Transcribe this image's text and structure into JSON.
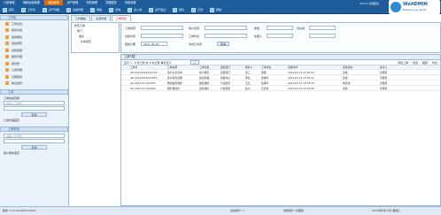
{
  "topnav": [
    "计划管理",
    "网络运维管理",
    "运营管理",
    "资产管理",
    "外勤管理",
    "流程服务",
    "系统设置"
  ],
  "toolbar": [
    "首页",
    "工作台",
    "资产管理",
    "设备管理",
    "网络",
    "查询",
    "出入库",
    "资产盘点",
    "报表",
    "日志",
    "帮助"
  ],
  "user": "admin [管理员]",
  "logo": {
    "name": "WeADMIN",
    "sub": "Powered by eSoft"
  },
  "left": {
    "panel1": "工作区",
    "menu": [
      "工作任务",
      "我的文档",
      "我的审批",
      "我的通知",
      "资料管理",
      "邮件管理",
      "通讯录",
      "公告管理",
      "日程安排",
      "信息发布"
    ],
    "panel2": "工单",
    "s1_title": "工单快速查看",
    "s1_placeholder": "请输入工单号",
    "btn": "查询",
    "s1_link": "工单管理首页",
    "s2_title": "工单查询",
    "s2_placeholder": "请输入关键字",
    "s2_link": "客户服务首页"
  },
  "tabs": [
    "工作面板",
    "资源管理",
    "工单列表"
  ],
  "tree": {
    "root": "所有工单",
    "items": [
      "部门",
      "组织",
      "基本配置"
    ]
  },
  "form": {
    "f1": "工单名称",
    "f2": "创建时间",
    "f3": "客户名称",
    "f4": "工单状态",
    "f5": "起始日期",
    "date": "2011-05-16",
    "f6": "类型",
    "f7": "处理人",
    "f8": "优先级",
    "check": "包含已关闭",
    "search": "查询"
  },
  "grid": {
    "title": "工单列表",
    "actions": [
      "添加工单",
      "修改",
      "删除",
      "导出"
    ],
    "pager": "显示 1 - 8 条记录 共 8 条记录 每页显示",
    "page": "1 / 1",
    "cols": [
      "",
      "工单号",
      "工单名称",
      "工单分类",
      "发起部门",
      "联系人",
      "工单状态",
      "创建时间",
      "完成状态",
      "提交人"
    ],
    "rows": [
      [
        "",
        "GD.2011021443A753",
        "客户信息查询",
        "客户服务",
        "客服部门",
        "张三",
        "受理",
        "2014-04-15 15:32:54",
        "完成",
        "管理员"
      ],
      [
        "",
        "GD.2011021443AH53",
        "客户投诉处理",
        "投诉处理",
        "客服中心",
        "李四",
        "处理中",
        "2014-04-15 15:35:11",
        "完成",
        "管理员"
      ],
      [
        "",
        "GD.2015-01-07DS21",
        "网络故障维修",
        "故障维修",
        "IT运维部",
        "王五",
        "处理中",
        "2014-04-15 15:33:35",
        "未完成",
        "管理员"
      ],
      [
        "",
        "GD.2015-01-07DS22",
        "服务器巡检",
        "巡检维护",
        "IT运维部",
        "赵六",
        "已完成",
        "2014-04-15 15:34:08",
        "完成",
        "管理员"
      ]
    ]
  },
  "status": {
    "version": "版本: 2.0.0.20200714193",
    "online": "在线用户: 1",
    "msg": "当前用户: 管理员",
    "time": "2014年4月15日 星期二"
  }
}
